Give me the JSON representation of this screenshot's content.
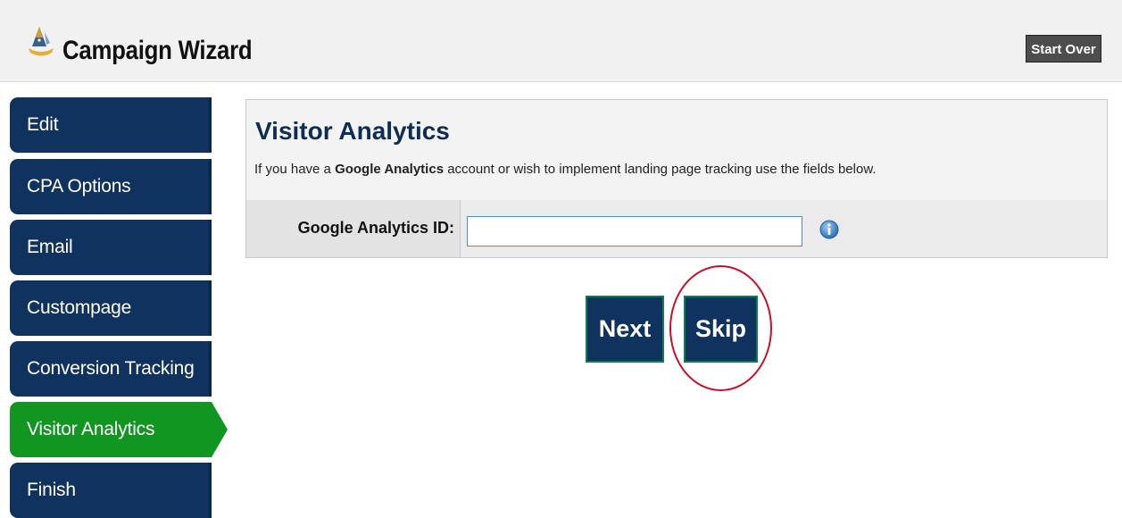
{
  "header": {
    "title": "Campaign Wizard",
    "logo_icon": "wizard-hat-icon",
    "start_over_label": "Start Over"
  },
  "sidebar": {
    "items": [
      {
        "label": "Edit",
        "active": false
      },
      {
        "label": "CPA Options",
        "active": false
      },
      {
        "label": "Email",
        "active": false
      },
      {
        "label": "Custompage",
        "active": false
      },
      {
        "label": "Conversion Tracking",
        "active": false
      },
      {
        "label": "Visitor Analytics",
        "active": true
      },
      {
        "label": "Finish",
        "active": false
      }
    ]
  },
  "main": {
    "title": "Visitor Analytics",
    "description": {
      "prefix": "If you have a ",
      "highlight": "Google Analytics",
      "suffix": " account or wish to implement landing page tracking use the fields below."
    },
    "field": {
      "label": "Google Analytics ID:",
      "value": "",
      "info_icon": "info-icon"
    },
    "buttons": {
      "next_label": "Next",
      "skip_label": "Skip"
    }
  },
  "colors": {
    "nav_bg": "#10325e",
    "nav_active": "#119622",
    "title_text": "#0d2d55",
    "highlight_circle": "#c8102e",
    "start_over_bg": "#4d4d4d"
  }
}
